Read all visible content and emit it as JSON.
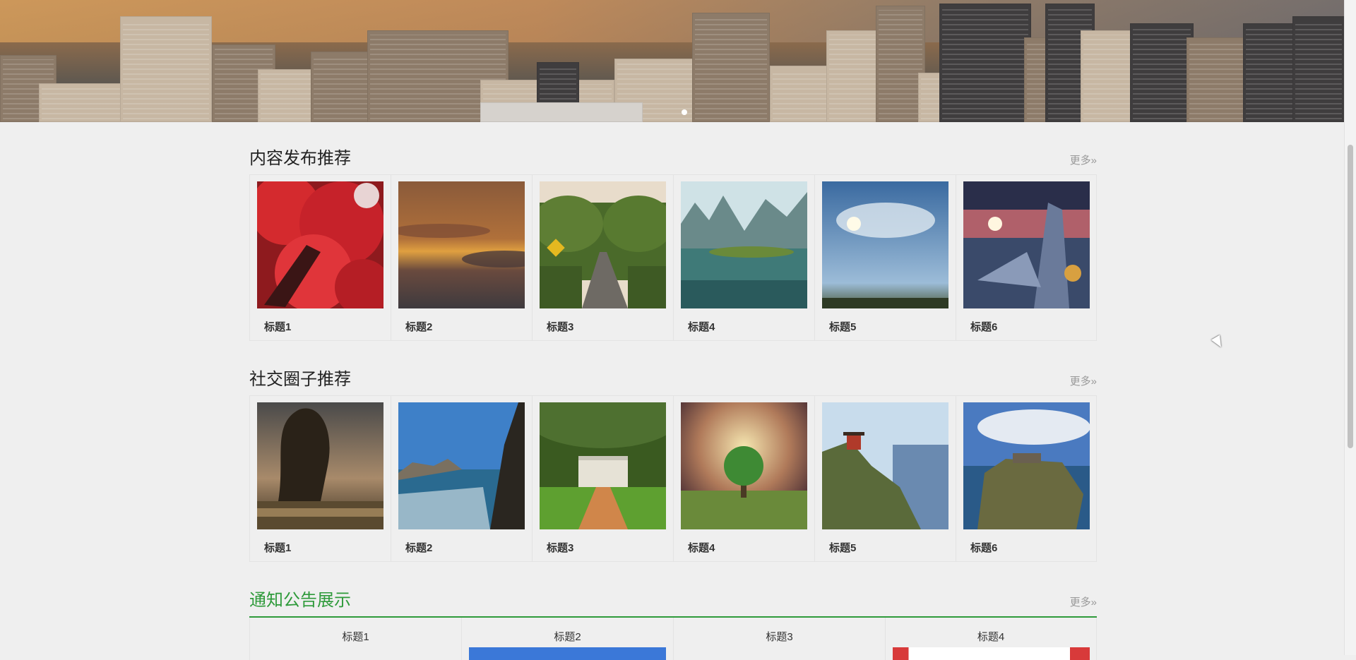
{
  "banner": {
    "image_name": "city-skyline-banner",
    "carousel_dots": 1
  },
  "sections": [
    {
      "title": "内容发布推荐",
      "more": "更多»",
      "items": [
        {
          "label": "标题1",
          "image": "red-maple-tree"
        },
        {
          "label": "标题2",
          "image": "orange-sunset-clouds"
        },
        {
          "label": "标题3",
          "image": "tree-tunnel-road"
        },
        {
          "label": "标题4",
          "image": "lake-mountains"
        },
        {
          "label": "标题5",
          "image": "sun-blue-sky"
        },
        {
          "label": "标题6",
          "image": "anime-fantasy-city"
        }
      ]
    },
    {
      "title": "社交圈子推荐",
      "more": "更多»",
      "items": [
        {
          "label": "标题1",
          "image": "willow-sunset-lake"
        },
        {
          "label": "标题2",
          "image": "coastal-rocks-sea"
        },
        {
          "label": "标题3",
          "image": "mansion-oak-alley"
        },
        {
          "label": "标题4",
          "image": "lone-green-tree"
        },
        {
          "label": "标题5",
          "image": "cliff-temple-sea"
        },
        {
          "label": "标题6",
          "image": "castle-on-cliff"
        }
      ]
    }
  ],
  "notice": {
    "title": "通知公告展示",
    "more": "更多»",
    "items": [
      {
        "label": "标题1"
      },
      {
        "label": "标题2"
      },
      {
        "label": "标题3"
      },
      {
        "label": "标题4"
      }
    ]
  },
  "colors": {
    "accent_green": "#2e9a3a",
    "page_bg": "#efefef"
  }
}
